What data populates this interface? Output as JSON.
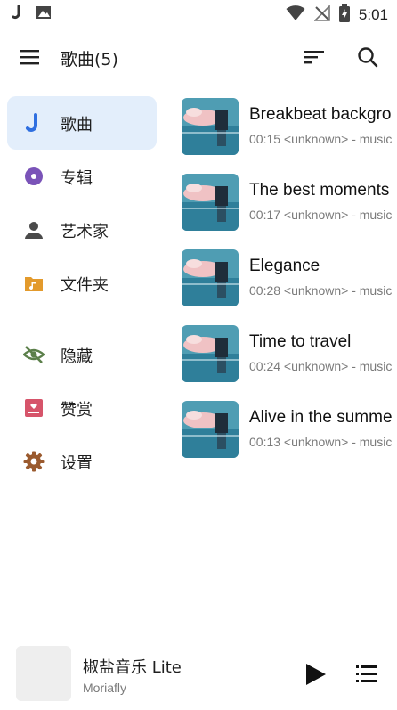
{
  "status_bar": {
    "time": "5:01",
    "icons": [
      "notification-j-icon",
      "image-notification-icon",
      "wifi-icon",
      "no-signal-icon",
      "battery-charging-icon"
    ]
  },
  "app_bar": {
    "title": "歌曲(5)",
    "icons": [
      "menu-icon",
      "sort-icon",
      "search-icon"
    ]
  },
  "nav": {
    "items": [
      {
        "label": "歌曲",
        "icon": "music-note-icon",
        "active": true,
        "color": "#2f6fe0"
      },
      {
        "label": "专辑",
        "icon": "album-icon",
        "active": false,
        "color": "#7a53b8"
      },
      {
        "label": "艺术家",
        "icon": "person-icon",
        "active": false,
        "color": "#4a4a4a"
      },
      {
        "label": "文件夹",
        "icon": "folder-icon",
        "active": false,
        "color": "#e39a2c"
      },
      {
        "label": "隐藏",
        "icon": "eye-off-icon",
        "active": false,
        "color": "#5b7f4a"
      },
      {
        "label": "赞赏",
        "icon": "donate-icon",
        "active": false,
        "color": "#d6546a"
      },
      {
        "label": "设置",
        "icon": "gear-icon",
        "active": false,
        "color": "#9a5a2e"
      }
    ]
  },
  "songs": [
    {
      "title": "Breakbeat backgro",
      "meta": "00:15 <unknown> - music"
    },
    {
      "title": "The best moments",
      "meta": "00:17 <unknown> - music"
    },
    {
      "title": "Elegance",
      "meta": "00:28 <unknown> - music"
    },
    {
      "title": "Time to travel",
      "meta": "00:24 <unknown> - music"
    },
    {
      "title": "Alive in the summe",
      "meta": "00:13 <unknown> - music"
    }
  ],
  "player": {
    "title": "椒盐音乐 Lite",
    "artist": "Moriafly",
    "icons": [
      "play-icon",
      "queue-list-icon"
    ]
  },
  "colors": {
    "active_nav_bg": "#e3eefb",
    "accent": "#2f6fe0",
    "text_primary": "#1f1f1f",
    "text_secondary": "#7a7a7a"
  }
}
